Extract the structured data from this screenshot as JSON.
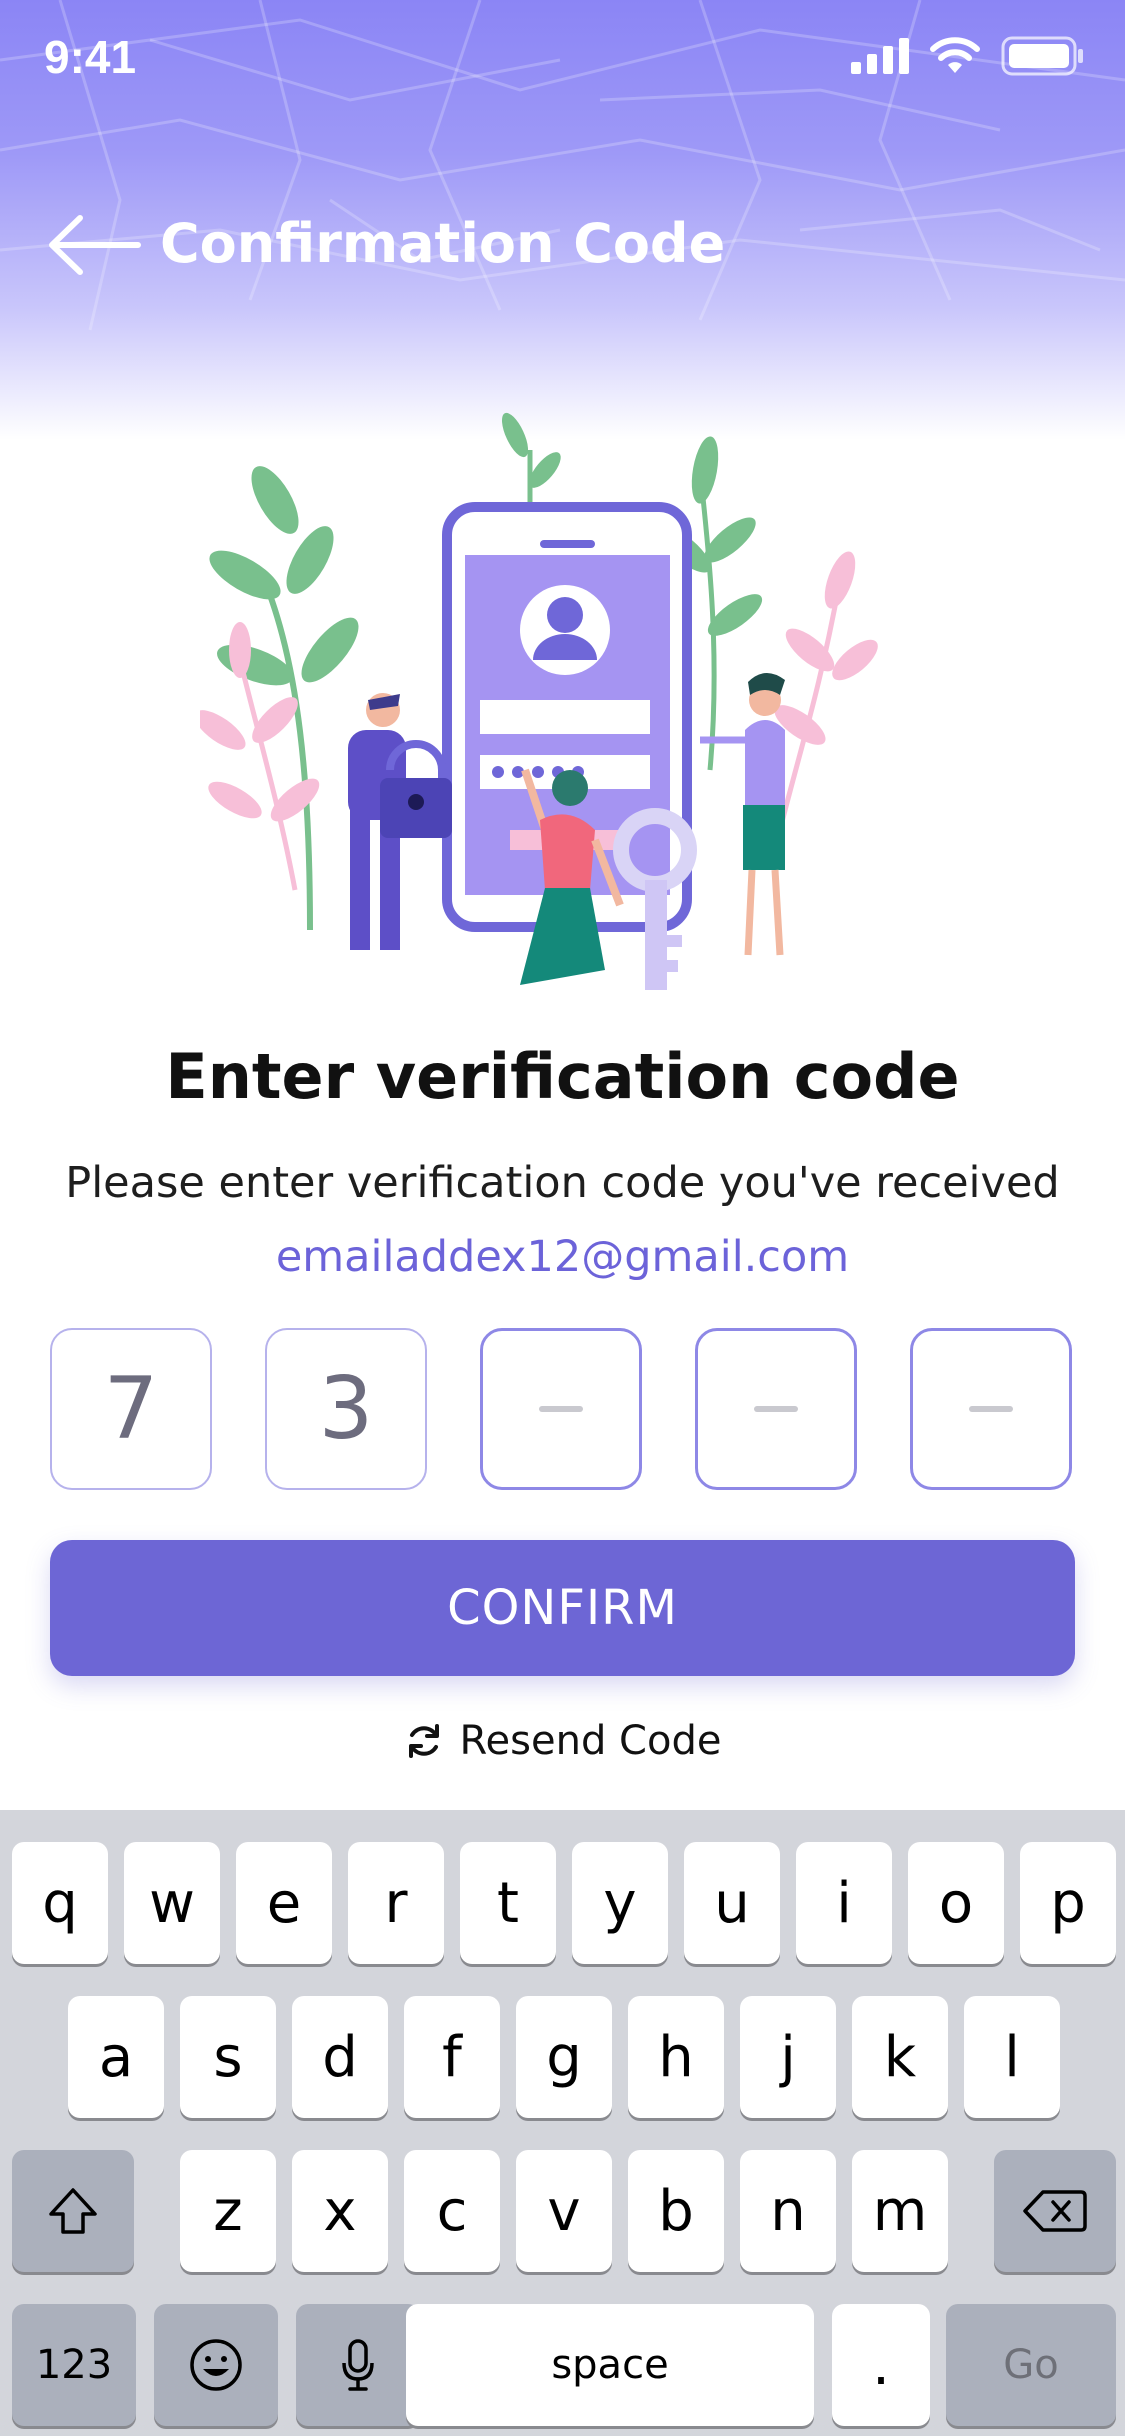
{
  "status_bar": {
    "time": "9:41"
  },
  "nav": {
    "title": "Confirmation Code"
  },
  "content": {
    "heading": "Enter verification code",
    "subtext": "Please enter verification code you've received",
    "email": "emailaddex12@gmail.com",
    "code_digits": [
      "7",
      "3",
      "",
      "",
      ""
    ],
    "confirm_label": "CONFIRM",
    "resend_label": "Resend Code"
  },
  "colors": {
    "accent": "#6d66d5",
    "email_text": "#6c63d9",
    "header_gradient_top": "#8b85f5"
  },
  "keyboard": {
    "row1": [
      "q",
      "w",
      "e",
      "r",
      "t",
      "y",
      "u",
      "i",
      "o",
      "p"
    ],
    "row2": [
      "a",
      "s",
      "d",
      "f",
      "g",
      "h",
      "j",
      "k",
      "l"
    ],
    "row3": [
      "z",
      "x",
      "c",
      "v",
      "b",
      "n",
      "m"
    ],
    "numbers_label": "123",
    "space_label": "space",
    "period_label": ".",
    "go_label": "Go"
  }
}
